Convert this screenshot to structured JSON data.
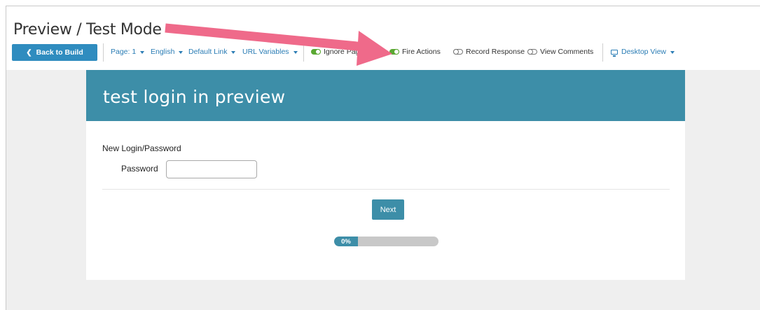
{
  "window": {
    "title": "Preview / Test Mode"
  },
  "toolbar": {
    "back_label": "Back to Build",
    "page_label": "Page: 1",
    "language_label": "English",
    "link_label": "Default Link",
    "url_vars_label": "URL Variables",
    "ignore_page_label": "Ignore Pag",
    "fire_actions_label": "Fire Actions",
    "record_response_label": "Record Response",
    "view_comments_label": "View Comments",
    "view_mode_label": "Desktop View",
    "toggles": {
      "ignore_page": true,
      "fire_actions": true,
      "record_response": false,
      "view_comments": false
    }
  },
  "survey": {
    "title": "test login in preview",
    "question_title": "New Login/Password",
    "password_label": "Password",
    "password_value": "",
    "next_label": "Next",
    "progress_text": "0%",
    "progress_value": 0
  },
  "colors": {
    "accent": "#2f8cbf",
    "header": "#3d8ea8",
    "toggle_on": "#5aa832",
    "arrow": "#ef6a8a"
  },
  "annotation": {
    "icon": "pink-arrow-icon"
  }
}
